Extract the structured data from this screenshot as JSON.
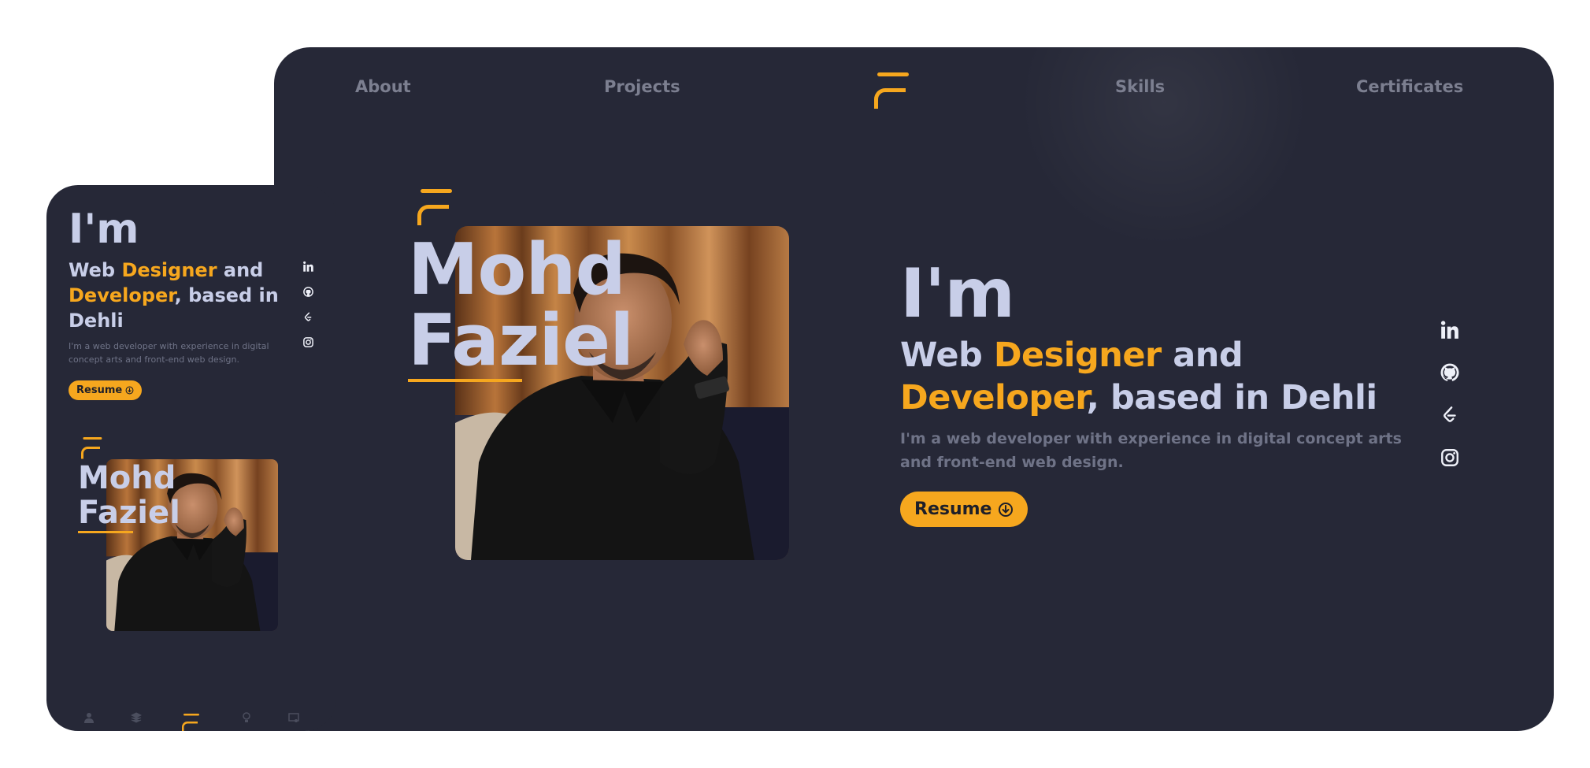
{
  "nav": {
    "items": [
      "About",
      "Projects",
      "Skills",
      "Certificates"
    ]
  },
  "hero": {
    "first_name": "Mohd",
    "last_name": "Faziel",
    "im": "I'm",
    "role_parts": [
      "Web ",
      "Designer",
      " and ",
      "Developer",
      ", based in Dehli"
    ],
    "description": "I'm a web developer with experience in digital concept arts and front-end web design.",
    "resume_label": "Resume"
  },
  "social": [
    "linkedin-icon",
    "github-icon",
    "leetcode-icon",
    "instagram-icon"
  ],
  "mobile_nav": [
    "user-icon",
    "stack-icon",
    "logo",
    "bulb-icon",
    "certificate-icon"
  ],
  "colors": {
    "background": "#262837",
    "accent": "#f6a71e",
    "text": "#c8cee8",
    "muted": "#6f7387"
  }
}
